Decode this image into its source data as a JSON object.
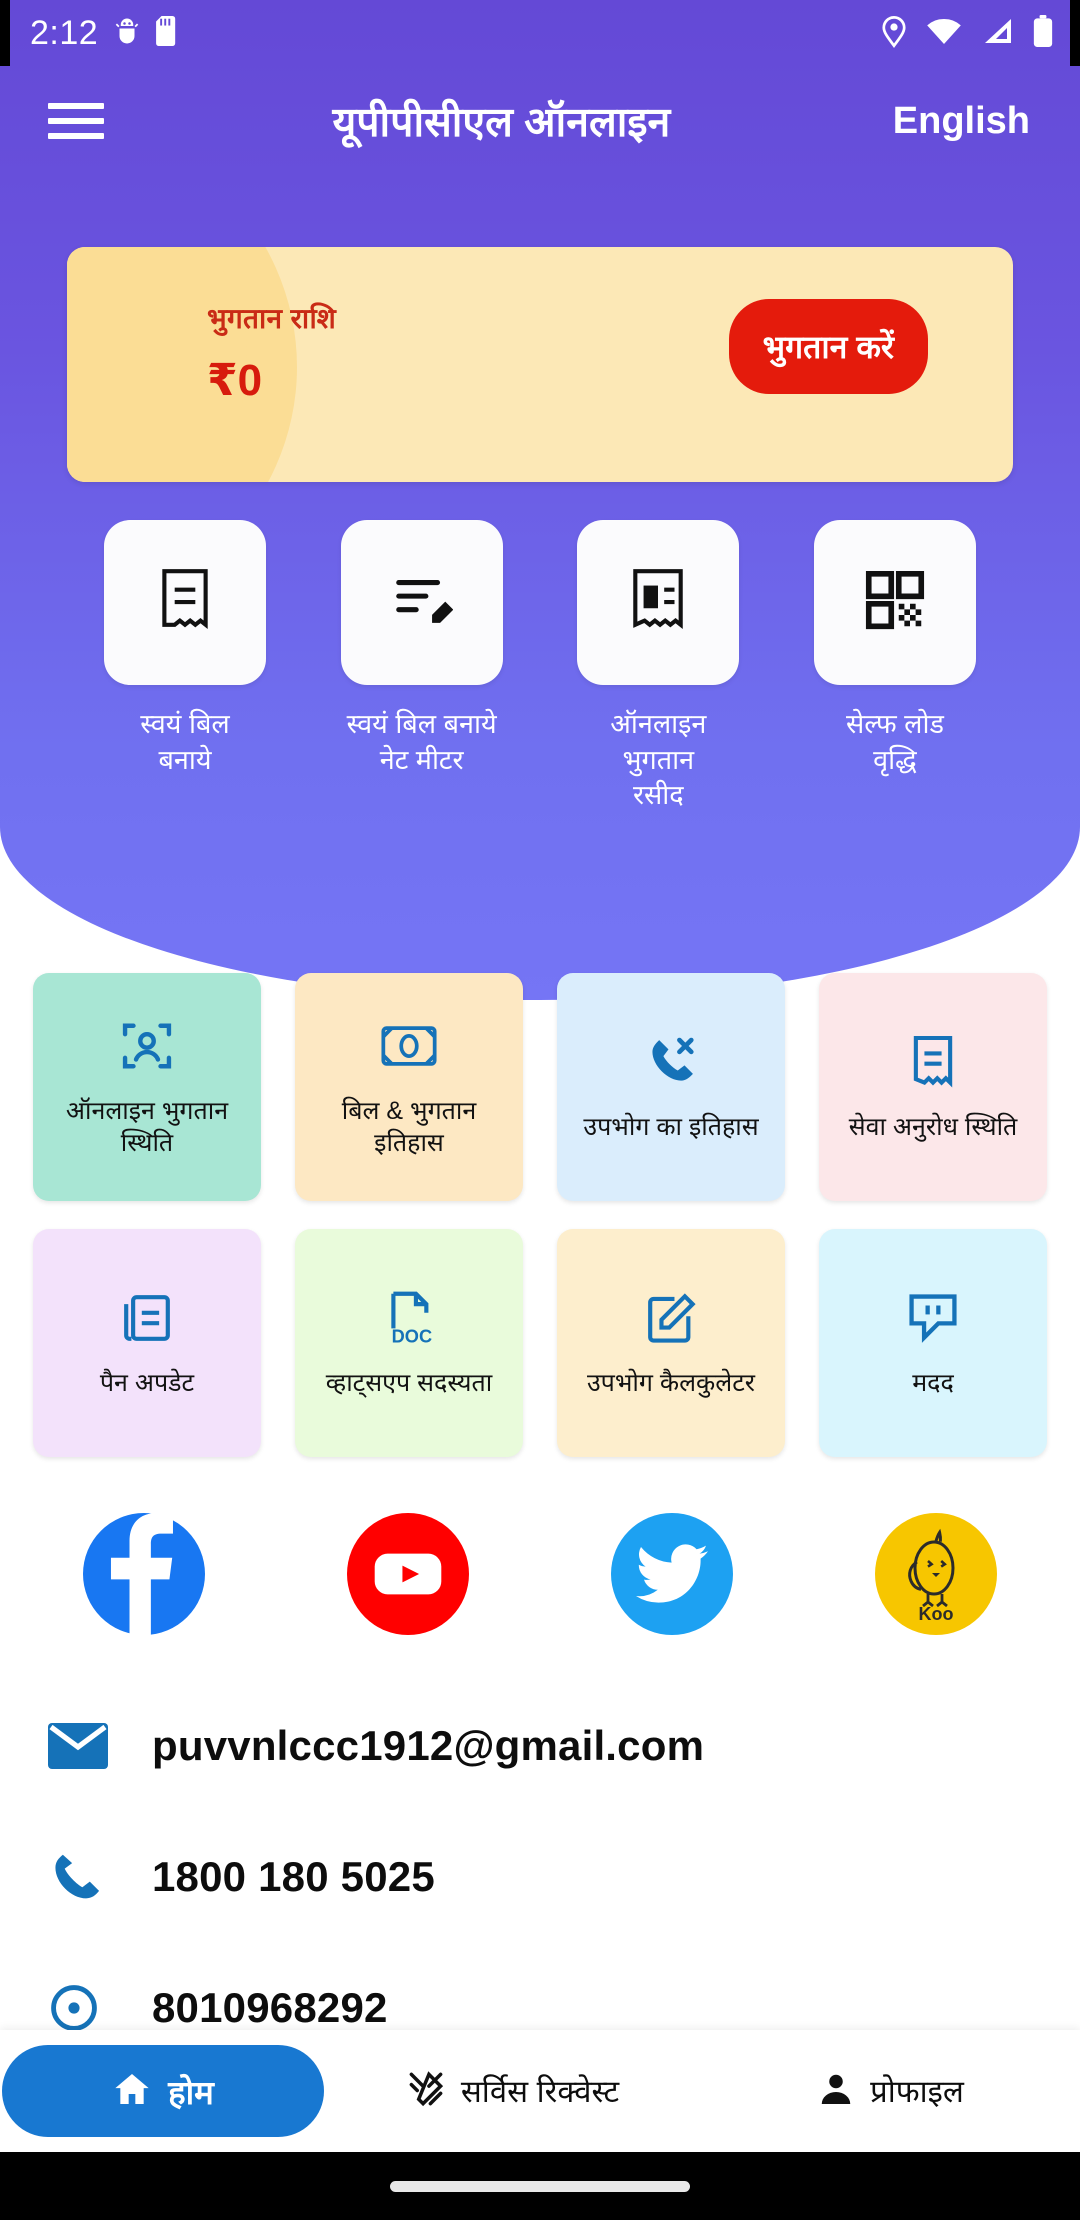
{
  "status_bar": {
    "time": "2:12",
    "left_icons": [
      "android-debug-icon",
      "sd-card-icon"
    ],
    "right_icons": [
      "location-icon",
      "wifi-icon",
      "signal-icon",
      "battery-icon"
    ]
  },
  "app_bar": {
    "menu_icon": "hamburger-menu-icon",
    "title": "यूपीपीसीएल ऑनलाइन",
    "language_button": "English"
  },
  "payment_card": {
    "label": "भुगतान राशि",
    "amount": "₹0",
    "pay_button": "भुगतान करें",
    "card_color": "#fce8b6",
    "button_color": "#e41b0c",
    "text_color": "#d71b0d"
  },
  "quick_tiles": [
    {
      "icon": "receipt-icon",
      "label": "स्वयं बिल\nबनाये"
    },
    {
      "icon": "edit-list-icon",
      "label": "स्वयं बिल बनाये\nनेट मीटर"
    },
    {
      "icon": "receipt-card-icon",
      "label": "ऑनलाइन भुगतान\nरसीद"
    },
    {
      "icon": "qr-code-icon",
      "label": "सेल्फ लोड\nवृद्धि"
    }
  ],
  "feature_cards": {
    "row1": [
      {
        "icon": "face-scan-icon",
        "label": "ऑनलाइन भुगतान\nस्थिति",
        "bg": "#a8e6d4"
      },
      {
        "icon": "money-note-icon",
        "label": "बिल & भुगतान\nइतिहास",
        "bg": "#fde8c3"
      },
      {
        "icon": "phone-missed-icon",
        "label": "उपभोग का इतिहास",
        "bg": "#daedfc"
      },
      {
        "icon": "receipt-icon",
        "label": "सेवा अनुरोध स्थिति",
        "bg": "#fce7e9"
      }
    ],
    "row2": [
      {
        "icon": "article-icon",
        "label": "पैन अपडेट",
        "bg": "#f3e2fb"
      },
      {
        "icon": "doc-file-icon",
        "label": "व्हाट्सएप  सदस्यता",
        "bg": "#e9fbdb"
      },
      {
        "icon": "edit-note-icon",
        "label": "उपभोग  कैलकुलेटर",
        "bg": "#fdeecd"
      },
      {
        "icon": "chat-help-icon",
        "label": "मदद",
        "bg": "#d9f5fd"
      }
    ],
    "icon_color": "#1572b8"
  },
  "social_links": [
    {
      "name": "facebook-icon",
      "color": "#1877f2"
    },
    {
      "name": "youtube-icon",
      "color": "#ff0000"
    },
    {
      "name": "twitter-icon",
      "color": "#1da1f2"
    },
    {
      "name": "koo-icon",
      "color": "#f7c600",
      "label": "Koo"
    }
  ],
  "contacts": [
    {
      "icon": "email-icon",
      "value": "puvvnlccc1912@gmail.com"
    },
    {
      "icon": "phone-icon",
      "value": "1800 180 5025"
    },
    {
      "icon": "support-icon",
      "value": "8010968292"
    }
  ],
  "bottom_nav": [
    {
      "icon": "home-icon",
      "label": "होम",
      "active": true
    },
    {
      "icon": "service-request-icon",
      "label": "सर्विस रिक्वेस्ट",
      "active": false
    },
    {
      "icon": "profile-icon",
      "label": "प्रोफाइल",
      "active": false
    }
  ],
  "theme": {
    "header_gradient_top": "#6449d6",
    "header_gradient_bottom": "#7575f5",
    "nav_active_color": "#1878d1"
  }
}
